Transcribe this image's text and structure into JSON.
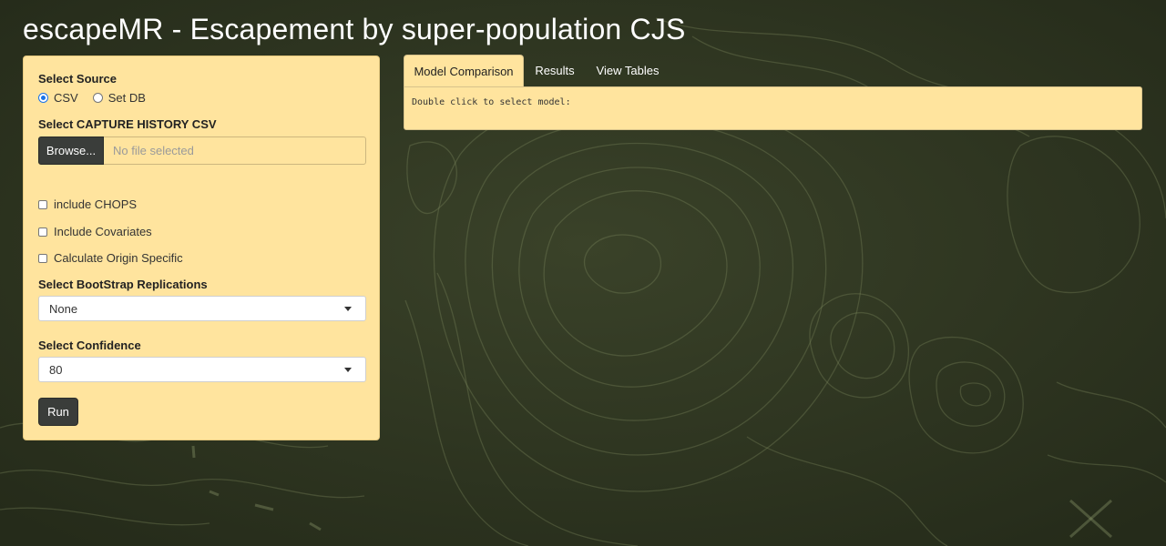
{
  "app": {
    "title": "escapeMR - Escapement by super-population CJS"
  },
  "sidebar": {
    "source_label": "Select Source",
    "source_options": [
      "CSV",
      "Set DB"
    ],
    "source_selected": "CSV",
    "capture_label": "Select CAPTURE HISTORY CSV",
    "browse_label": "Browse...",
    "file_placeholder": "No file selected",
    "checkboxes": [
      {
        "label": "include CHOPS",
        "checked": false
      },
      {
        "label": "Include Covariates",
        "checked": false
      },
      {
        "label": "Calculate Origin Specific",
        "checked": false
      }
    ],
    "bootstrap_label": "Select BootStrap Replications",
    "bootstrap_value": "None",
    "confidence_label": "Select Confidence",
    "confidence_value": "80",
    "run_label": "Run"
  },
  "tabs": [
    {
      "label": "Model Comparison",
      "active": true
    },
    {
      "label": "Results",
      "active": false
    },
    {
      "label": "View Tables",
      "active": false
    }
  ],
  "panel": {
    "text": "Double click to select model:"
  },
  "colors": {
    "panel_bg": "#ffe49e",
    "page_bg": "#2c3320",
    "button_bg": "#3a3d3a",
    "accent": "#1a73e8"
  }
}
